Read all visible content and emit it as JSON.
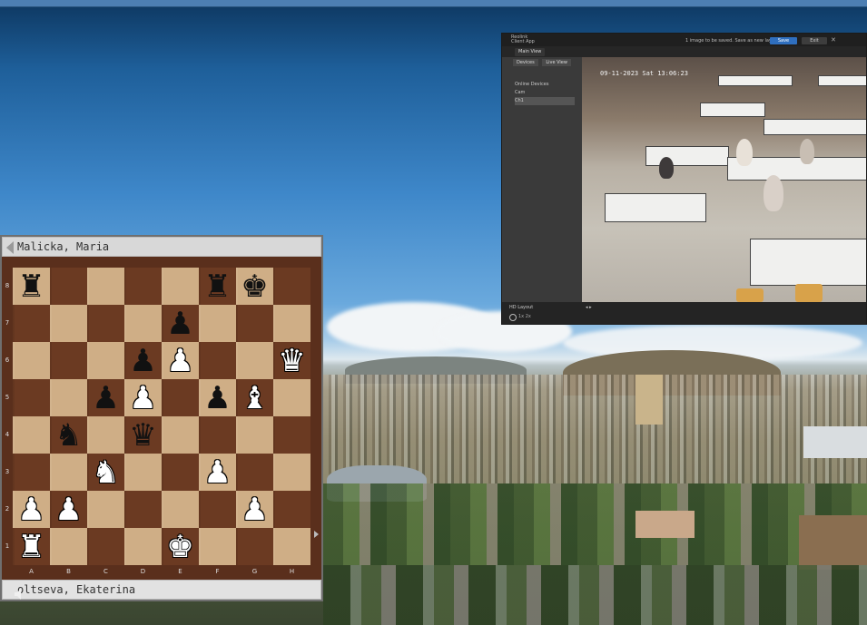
{
  "camera_window": {
    "brand": "Reolink",
    "brand_sub": "Client App",
    "status_text": "1 image to be saved. Save as new layout",
    "save_label": "Save",
    "cancel_label": "Exit",
    "tab_label": "Main View",
    "subtabs": [
      "Devices",
      "Live View"
    ],
    "tree_items": [
      "Online Devices",
      "Cam",
      "Ch1"
    ],
    "timestamp": "09-11-2023 Sat 13:06:23",
    "layout_label": "HD Layout",
    "zoom_label": "1x  2x"
  },
  "chess": {
    "top_player": "Malicka, Maria",
    "bottom_player": "oltseva, Ekaterina",
    "files": [
      "A",
      "B",
      "C",
      "D",
      "E",
      "F",
      "G",
      "H"
    ],
    "ranks": [
      "8",
      "7",
      "6",
      "5",
      "4",
      "3",
      "2",
      "1"
    ],
    "position": [
      [
        "bR",
        "",
        "",
        "",
        "",
        "bR",
        "bK",
        ""
      ],
      [
        "",
        "",
        "",
        "",
        "bP",
        "",
        "",
        ""
      ],
      [
        "",
        "",
        "",
        "bP",
        "wP",
        "",
        "",
        "wQ"
      ],
      [
        "",
        "",
        "bP",
        "wP",
        "",
        "bP",
        "wB",
        ""
      ],
      [
        "",
        "bN",
        "",
        "bQ",
        "",
        "",
        "",
        ""
      ],
      [
        "",
        "",
        "wN",
        "",
        "",
        "wP",
        "",
        ""
      ],
      [
        "wP",
        "wP",
        "",
        "",
        "",
        "",
        "wP",
        ""
      ],
      [
        "wR",
        "",
        "",
        "",
        "wK",
        "",
        "",
        ""
      ]
    ]
  },
  "icons": {
    "speaker": "speaker-icon",
    "close": "close-icon"
  }
}
